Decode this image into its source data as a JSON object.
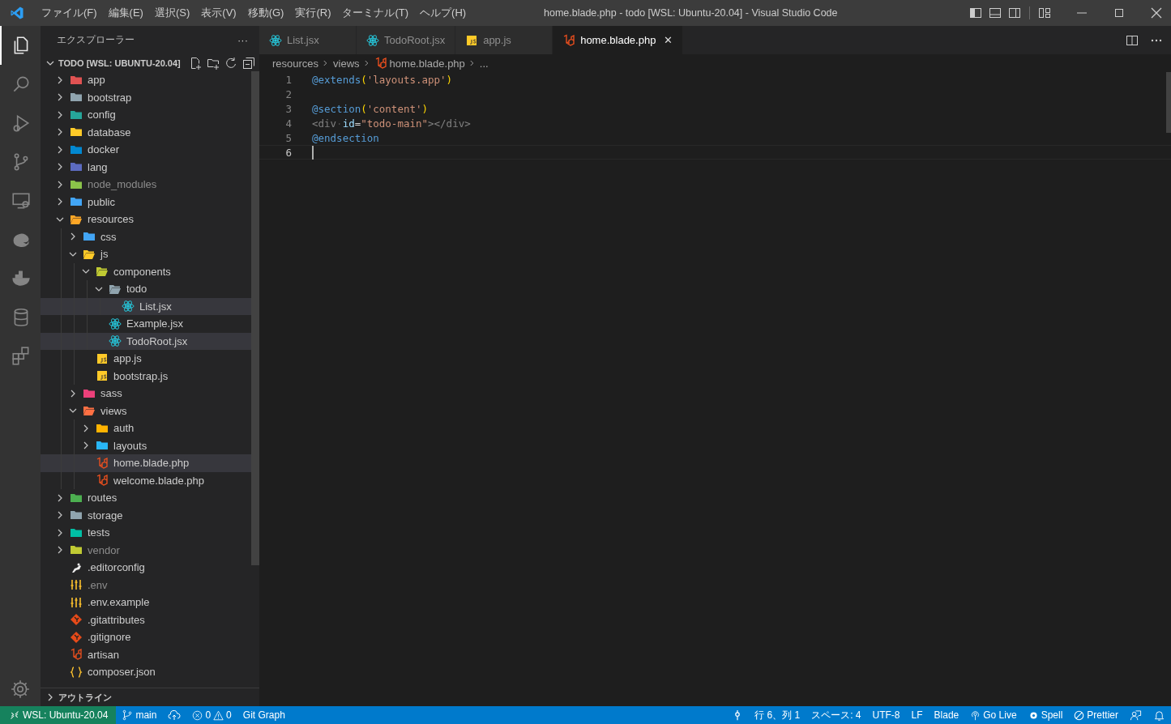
{
  "window": {
    "title": "home.blade.php - todo [WSL: Ubuntu-20.04] - Visual Studio Code"
  },
  "menu": [
    "ファイル(F)",
    "編集(E)",
    "選択(S)",
    "表示(V)",
    "移動(G)",
    "実行(R)",
    "ターミナル(T)",
    "ヘルプ(H)"
  ],
  "activity_bar": [
    {
      "kind": "explorer",
      "selected": true
    },
    {
      "kind": "search",
      "selected": false
    },
    {
      "kind": "debug",
      "selected": false
    },
    {
      "kind": "git",
      "selected": false
    },
    {
      "kind": "remote",
      "selected": false
    },
    {
      "kind": "edge",
      "selected": false
    },
    {
      "kind": "docker",
      "selected": false
    },
    {
      "kind": "database",
      "selected": false
    },
    {
      "kind": "extensions",
      "selected": false
    }
  ],
  "sidebar": {
    "title": "エクスプローラー",
    "more": "···",
    "section": "TODO [WSL: UBUNTU-20.04]",
    "outline": "アウトライン",
    "tree": [
      {
        "name": "app",
        "kind": "folder",
        "color": "#e05252",
        "expanded": false,
        "ignored": false,
        "selected": false
      },
      {
        "name": "bootstrap",
        "kind": "folder",
        "color": "#90a4ae",
        "expanded": false,
        "ignored": false,
        "selected": false
      },
      {
        "name": "config",
        "kind": "folder",
        "color": "#26a69a",
        "expanded": false,
        "ignored": false,
        "selected": false
      },
      {
        "name": "database",
        "kind": "folder",
        "color": "#ffca28",
        "expanded": false,
        "ignored": false,
        "selected": false
      },
      {
        "name": "docker",
        "kind": "folder",
        "color": "#0288d1",
        "expanded": false,
        "ignored": false,
        "selected": false
      },
      {
        "name": "lang",
        "kind": "folder",
        "color": "#5c6bc0",
        "expanded": false,
        "ignored": false,
        "selected": false
      },
      {
        "name": "node_modules",
        "kind": "folder",
        "color": "#8bc34a",
        "expanded": false,
        "ignored": true,
        "selected": false
      },
      {
        "name": "public",
        "kind": "folder",
        "color": "#42a5f5",
        "expanded": false,
        "ignored": false,
        "selected": false
      },
      {
        "name": "resources",
        "kind": "folder",
        "color": "#ffa726",
        "expanded": true,
        "ignored": false,
        "selected": false,
        "children": [
          {
            "name": "css",
            "kind": "folder",
            "color": "#42a5f5",
            "expanded": false,
            "ignored": false,
            "selected": false
          },
          {
            "name": "js",
            "kind": "folder",
            "color": "#ffca28",
            "expanded": true,
            "ignored": false,
            "selected": false,
            "children": [
              {
                "name": "components",
                "kind": "folder",
                "color": "#c0ca33",
                "expanded": true,
                "ignored": false,
                "selected": false,
                "children": [
                  {
                    "name": "todo",
                    "kind": "folder",
                    "color": "#90a4ae",
                    "expanded": true,
                    "ignored": false,
                    "selected": false,
                    "children": [
                      {
                        "name": "List.jsx",
                        "kind": "react",
                        "ignored": false,
                        "selected": true
                      }
                    ]
                  },
                  {
                    "name": "Example.jsx",
                    "kind": "react",
                    "ignored": false,
                    "selected": false
                  },
                  {
                    "name": "TodoRoot.jsx",
                    "kind": "react",
                    "ignored": false,
                    "selected": true
                  }
                ]
              },
              {
                "name": "app.js",
                "kind": "js",
                "ignored": false,
                "selected": false
              },
              {
                "name": "bootstrap.js",
                "kind": "js",
                "ignored": false,
                "selected": false
              }
            ]
          },
          {
            "name": "sass",
            "kind": "folder",
            "color": "#ec407a",
            "expanded": false,
            "ignored": false,
            "selected": false
          },
          {
            "name": "views",
            "kind": "folder",
            "color": "#ff7043",
            "expanded": true,
            "ignored": false,
            "selected": false,
            "children": [
              {
                "name": "auth",
                "kind": "folder",
                "color": "#ffb300",
                "expanded": false,
                "ignored": false,
                "selected": false
              },
              {
                "name": "layouts",
                "kind": "folder",
                "color": "#29b6f6",
                "expanded": false,
                "ignored": false,
                "selected": false
              },
              {
                "name": "home.blade.php",
                "kind": "blade",
                "ignored": false,
                "selected": true
              },
              {
                "name": "welcome.blade.php",
                "kind": "blade",
                "ignored": false,
                "selected": false
              }
            ]
          }
        ]
      },
      {
        "name": "routes",
        "kind": "folder",
        "color": "#4caf50",
        "expanded": false,
        "ignored": false,
        "selected": false
      },
      {
        "name": "storage",
        "kind": "folder",
        "color": "#90a4ae",
        "expanded": false,
        "ignored": false,
        "selected": false
      },
      {
        "name": "tests",
        "kind": "folder",
        "color": "#00bfa5",
        "expanded": false,
        "ignored": false,
        "selected": false
      },
      {
        "name": "vendor",
        "kind": "folder",
        "color": "#c0ca33",
        "expanded": false,
        "ignored": true,
        "selected": false
      },
      {
        "name": ".editorconfig",
        "kind": "config",
        "ignored": false,
        "selected": false
      },
      {
        "name": ".env",
        "kind": "env",
        "ignored": true,
        "selected": false
      },
      {
        "name": ".env.example",
        "kind": "env",
        "ignored": false,
        "selected": false
      },
      {
        "name": ".gitattributes",
        "kind": "git",
        "ignored": false,
        "selected": false
      },
      {
        "name": ".gitignore",
        "kind": "git",
        "ignored": false,
        "selected": false
      },
      {
        "name": "artisan",
        "kind": "blade",
        "ignored": false,
        "selected": false
      },
      {
        "name": "composer.json",
        "kind": "json",
        "ignored": false,
        "selected": false
      }
    ]
  },
  "tabs": [
    {
      "label": "List.jsx",
      "kind": "react",
      "selected": false
    },
    {
      "label": "TodoRoot.jsx",
      "kind": "react",
      "selected": false
    },
    {
      "label": "app.js",
      "kind": "js",
      "selected": false
    },
    {
      "label": "home.blade.php",
      "kind": "blade",
      "selected": true,
      "close": "✕"
    }
  ],
  "breadcrumbs": [
    {
      "label": "resources",
      "kind": "text"
    },
    {
      "label": "views",
      "kind": "text"
    },
    {
      "label": "home.blade.php",
      "kind": "blade"
    },
    {
      "label": "...",
      "kind": "text"
    }
  ],
  "editor": {
    "lines": [
      {
        "number": "1",
        "current": false,
        "tokens": [
          {
            "t": "@extends",
            "kind": "directive"
          },
          {
            "t": "(",
            "kind": "paren"
          },
          {
            "t": "'layouts.app'",
            "kind": "string"
          },
          {
            "t": ")",
            "kind": "paren"
          }
        ]
      },
      {
        "number": "2",
        "current": false
      },
      {
        "number": "3",
        "current": false,
        "tokens": [
          {
            "t": "@section",
            "kind": "directive"
          },
          {
            "t": "(",
            "kind": "paren"
          },
          {
            "t": "'content'",
            "kind": "string"
          },
          {
            "t": ")",
            "kind": "paren"
          }
        ]
      },
      {
        "number": "4",
        "current": false,
        "tokens": [
          {
            "t": "<div",
            "kind": "tag"
          },
          {
            "t": "·",
            "kind": "ws"
          },
          {
            "t": "id",
            "kind": "attr"
          },
          {
            "t": "=",
            "kind": "plain"
          },
          {
            "t": "\"todo-main\"",
            "kind": "string"
          },
          {
            "t": "></div>",
            "kind": "tag"
          }
        ]
      },
      {
        "number": "5",
        "current": false,
        "tokens": [
          {
            "t": "@endsection",
            "kind": "directive"
          }
        ]
      },
      {
        "number": "6",
        "current": true
      }
    ]
  },
  "status_bar": {
    "remote": "WSL: Ubuntu-20.04",
    "branch": "main",
    "errors": "0",
    "warnings": "0",
    "git_graph": "Git Graph",
    "right": [
      {
        "kind": "location"
      },
      {
        "kind": "text",
        "label": "行 6、列 1"
      },
      {
        "kind": "text",
        "label": "スペース: 4"
      },
      {
        "kind": "text",
        "label": "UTF-8"
      },
      {
        "kind": "text",
        "label": "LF"
      },
      {
        "kind": "text",
        "label": "Blade"
      },
      {
        "kind": "golive",
        "label": "Go Live"
      },
      {
        "kind": "spell",
        "label": "Spell"
      },
      {
        "kind": "prettier",
        "label": "Prettier"
      },
      {
        "kind": "feedback"
      },
      {
        "kind": "bell"
      }
    ]
  }
}
